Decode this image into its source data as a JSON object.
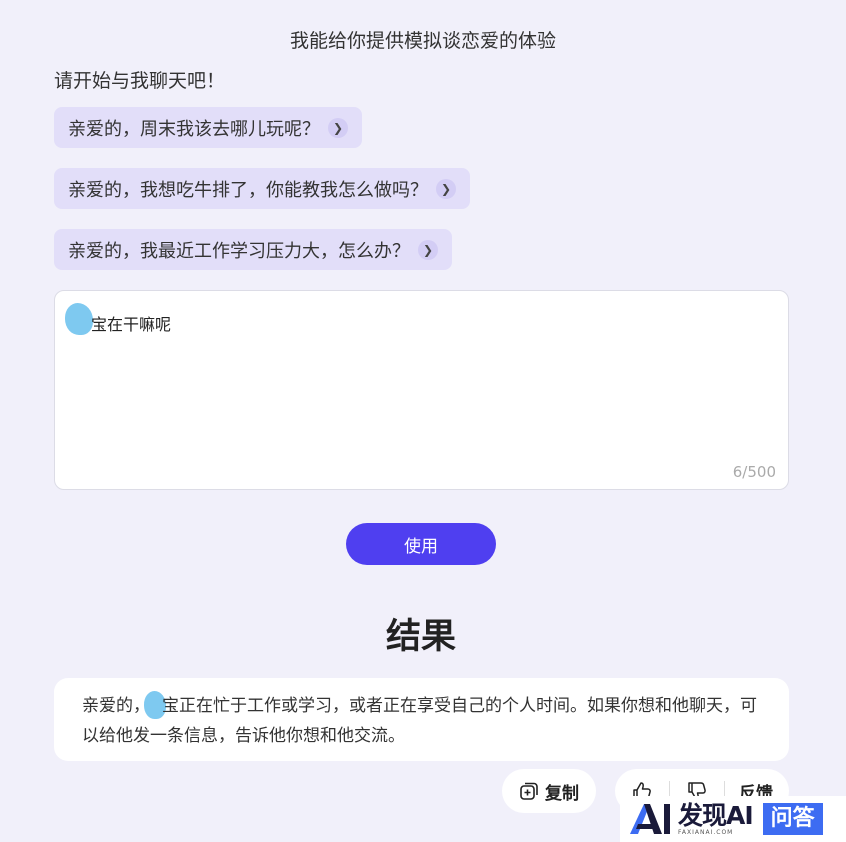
{
  "intro": {
    "subtitle": "我能给你提供模拟谈恋爱的体验",
    "greeting": "请开始与我聊天吧！"
  },
  "suggestions": [
    {
      "label": "亲爱的，周末我该去哪儿玩呢？"
    },
    {
      "label": "亲爱的，我想吃牛排了，你能教我怎么做吗？"
    },
    {
      "label": "亲爱的，我最近工作学习压力大，怎么办？"
    }
  ],
  "input": {
    "value": "宝在干嘛呢",
    "counter": "6/500"
  },
  "use_button": "使用",
  "result": {
    "title": "结果",
    "text_before": "亲爱的，",
    "text_after": "宝正在忙于工作或学习，或者正在享受自己的个人时间。如果你想和他聊天，可以给他发一条信息，告诉他你想和他交流。"
  },
  "actions": {
    "copy": "复制",
    "feedback": "反馈"
  },
  "watermark": {
    "brand": "发现AI",
    "domain": "FAXIANAI.COM",
    "badge": "问答"
  },
  "colors": {
    "accent": "#4f3ff0",
    "suggestion_bg": "#e2def9",
    "page_bg": "#f1f0fa"
  }
}
